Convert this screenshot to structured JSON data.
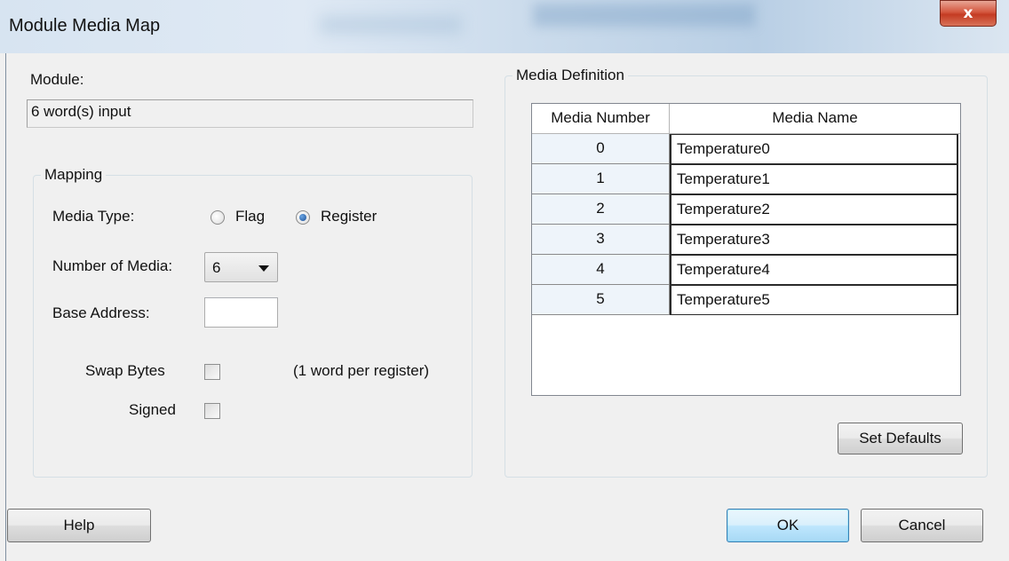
{
  "window": {
    "title": "Module Media Map",
    "close_label": "x"
  },
  "module": {
    "label": "Module:",
    "value": "6 word(s) input"
  },
  "mapping": {
    "group_label": "Mapping",
    "media_type_label": "Media Type:",
    "flag_label": "Flag",
    "register_label": "Register",
    "selected_media_type": "Register",
    "number_of_media_label": "Number of Media:",
    "number_of_media_value": "6",
    "base_address_label": "Base Address:",
    "base_address_value": "",
    "swap_bytes_label": "Swap Bytes",
    "swap_bytes_checked": false,
    "swap_note": "(1 word per register)",
    "signed_label": "Signed",
    "signed_checked": false
  },
  "media_definition": {
    "group_label": "Media Definition",
    "columns": [
      "Media Number",
      "Media Name"
    ],
    "rows": [
      {
        "number": "0",
        "name": "Temperature0"
      },
      {
        "number": "1",
        "name": "Temperature1"
      },
      {
        "number": "2",
        "name": "Temperature2"
      },
      {
        "number": "3",
        "name": "Temperature3"
      },
      {
        "number": "4",
        "name": "Temperature4"
      },
      {
        "number": "5",
        "name": "Temperature5"
      }
    ],
    "set_defaults_label": "Set Defaults"
  },
  "buttons": {
    "help": "Help",
    "ok": "OK",
    "cancel": "Cancel"
  }
}
